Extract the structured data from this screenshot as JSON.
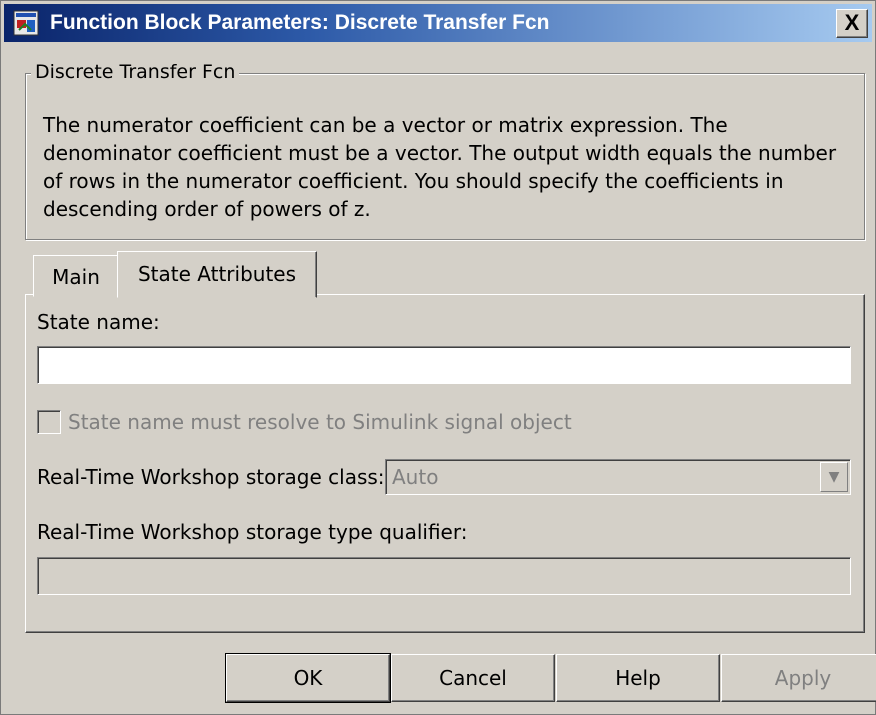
{
  "window": {
    "title": "Function Block Parameters: Discrete Transfer Fcn",
    "close_label": "X",
    "icon": "simulink-block-icon"
  },
  "group": {
    "legend": "Discrete Transfer Fcn",
    "description": "The numerator coefficient can be a vector or matrix expression. The denominator coefficient must be a vector. The output width equals the number of rows in the numerator coefficient. You should specify the coefficients in descending order of powers of z."
  },
  "tabs": [
    {
      "label": "Main",
      "active": false
    },
    {
      "label": "State Attributes",
      "active": true
    }
  ],
  "state_attributes": {
    "state_name_label": "State name:",
    "state_name_value": "",
    "resolve_checkbox_label": "State name must resolve to Simulink signal object",
    "resolve_checked": false,
    "storage_class_label": "Real-Time Workshop storage class:",
    "storage_class_value": "Auto",
    "type_qualifier_label": "Real-Time Workshop storage type qualifier:",
    "type_qualifier_value": ""
  },
  "buttons": {
    "ok": "OK",
    "cancel": "Cancel",
    "help": "Help",
    "apply": "Apply"
  }
}
